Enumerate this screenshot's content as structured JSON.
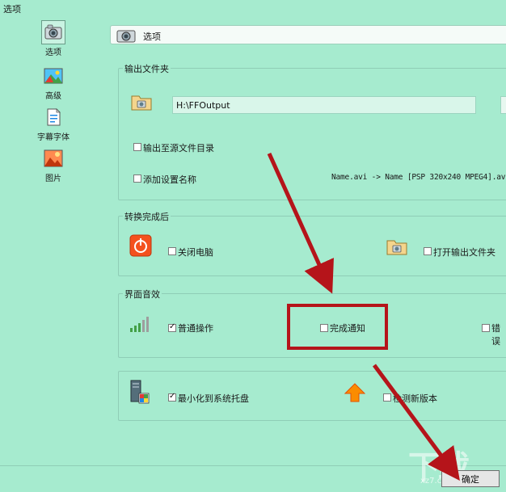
{
  "window": {
    "title": "选项"
  },
  "sidebar": {
    "items": [
      {
        "label": "选项",
        "icon": "options-icon",
        "selected": true
      },
      {
        "label": "高级",
        "icon": "landscape-image-icon",
        "selected": false
      },
      {
        "label": "字幕字体",
        "icon": "document-icon",
        "selected": false
      },
      {
        "label": "图片",
        "icon": "picture-icon",
        "selected": false
      }
    ]
  },
  "header": {
    "title": "选项"
  },
  "output_folder": {
    "group_label": "输出文件夹",
    "path_value": "H:\\FFOutput",
    "checkbox_output_to_source": {
      "label": "输出至源文件目录",
      "checked": false
    },
    "checkbox_add_setting_name": {
      "label": "添加设置名称",
      "checked": false
    },
    "name_preview": "Name.avi  -> Name [PSP 320x240 MPEG4].avi"
  },
  "after_conversion": {
    "group_label": "转换完成后",
    "checkbox_shutdown": {
      "label": "关闭电脑",
      "checked": false
    },
    "checkbox_open_output": {
      "label": "打开输出文件夹",
      "checked": false
    }
  },
  "ui_sound": {
    "group_label": "界面音效",
    "checkbox_normal": {
      "label": "普通操作",
      "checked": true
    },
    "checkbox_complete": {
      "label": "完成通知",
      "checked": false
    },
    "checkbox_error": {
      "label": "错误",
      "checked": false
    }
  },
  "system": {
    "checkbox_minimize_tray": {
      "label": "最小化到系统托盘",
      "checked": true
    },
    "checkbox_check_update": {
      "label": "检测新版本",
      "checked": false
    }
  },
  "footer": {
    "ok_label": "确定"
  },
  "watermark": {
    "text": "下载",
    "subtext": "xz7.com"
  },
  "colors": {
    "background": "#a6ebcf",
    "annotation_red": "#b5141a"
  }
}
